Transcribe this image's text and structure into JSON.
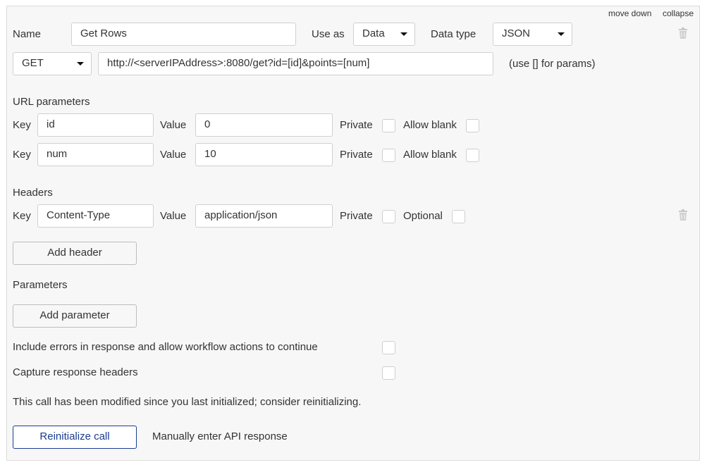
{
  "header_links": {
    "move_down": "move down",
    "collapse": "collapse"
  },
  "call": {
    "name_label": "Name",
    "name_value": "Get Rows",
    "use_as_label": "Use as",
    "use_as_value": "Data",
    "data_type_label": "Data type",
    "data_type_value": "JSON",
    "method_value": "GET",
    "url_value": "http://<serverIPAddress>:8080/get?id=[id]&points=[num]",
    "url_hint": "(use [] for params)"
  },
  "url_parameters": {
    "title": "URL parameters",
    "key_label": "Key",
    "value_label": "Value",
    "private_label": "Private",
    "allow_blank_label": "Allow blank",
    "rows": [
      {
        "key": "id",
        "value": "0"
      },
      {
        "key": "num",
        "value": "10"
      }
    ]
  },
  "headers": {
    "title": "Headers",
    "key_label": "Key",
    "value_label": "Value",
    "private_label": "Private",
    "optional_label": "Optional",
    "rows": [
      {
        "key": "Content-Type",
        "value": "application/json"
      }
    ],
    "add_button": "Add header"
  },
  "parameters": {
    "title": "Parameters",
    "add_button": "Add parameter"
  },
  "options": {
    "include_errors": "Include errors in response and allow workflow actions to continue",
    "capture_headers": "Capture response headers"
  },
  "notice": "This call has been modified since you last initialized; consider reinitializing.",
  "actions": {
    "reinitialize": "Reinitialize call",
    "manual_entry": "Manually enter API response"
  },
  "icons": {
    "delete_call": "trash-icon",
    "delete_header": "trash-icon",
    "dropdown": "caret-down-icon"
  },
  "colors": {
    "primary": "#1a3d8f",
    "panel_bg": "#f7f7f7",
    "border": "#d0d0d0"
  }
}
